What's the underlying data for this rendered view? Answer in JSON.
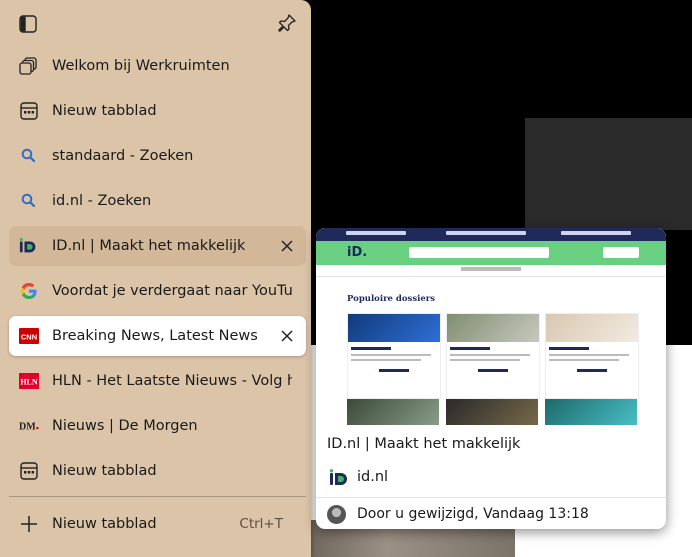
{
  "sidebar": {
    "tabs": [
      {
        "label": "Welkom bij Werkruimten",
        "icon": "workspaces-icon"
      },
      {
        "label": "Nieuw tabblad",
        "icon": "new-tab-page-icon"
      },
      {
        "label": "standaard - Zoeken",
        "icon": "search-icon"
      },
      {
        "label": "id.nl - Zoeken",
        "icon": "search-icon"
      },
      {
        "label": "ID.nl | Maakt het makkelijk",
        "icon": "idnl-favicon",
        "active": true
      },
      {
        "label": "Voordat je verdergaat naar YouTube",
        "icon": "google-favicon"
      },
      {
        "label": "Breaking News, Latest News and Videos | CNN",
        "icon": "cnn-favicon",
        "hovered": true
      },
      {
        "label": "HLN - Het Laatste Nieuws - Volg het nieuws",
        "icon": "hln-favicon"
      },
      {
        "label": "Nieuws | De Morgen",
        "icon": "demorgen-favicon"
      },
      {
        "label": "Nieuw tabblad",
        "icon": "new-tab-page-icon"
      }
    ],
    "new_tab": {
      "label": "Nieuw tabblad",
      "shortcut": "Ctrl+T"
    }
  },
  "hover_card": {
    "title": "ID.nl | Maakt het makkelijk",
    "domain": "id.nl",
    "meta": "Door u gewijzigd, Vandaag 13:18",
    "thumbnail": {
      "logo_text": "iD.",
      "section_title": "Populoire dossiers"
    }
  },
  "colors": {
    "sidebar_bg": "#dcc4a9",
    "active_tab": "#d2b799",
    "idnl_green": "#6ad081",
    "idnl_navy": "#1f2a5a"
  }
}
